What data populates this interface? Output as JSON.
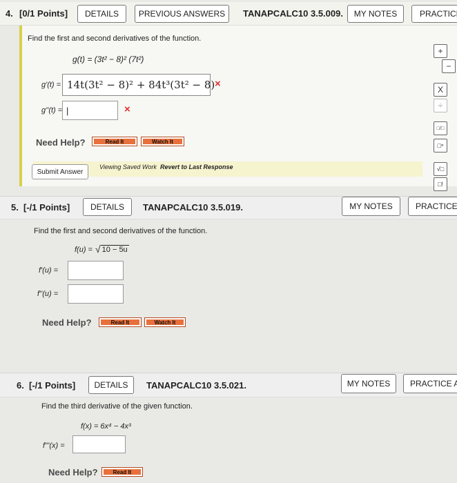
{
  "q4": {
    "number": "4.",
    "points": "[0/1 Points]",
    "details": "DETAILS",
    "previous_answers": "PREVIOUS ANSWERS",
    "code": "TANAPCALC10 3.5.009.",
    "my_notes": "MY NOTES",
    "practice": "PRACTICE",
    "prompt": "Find the first and second derivatives of the function.",
    "function": "g(t) = (3t² − 8)² (7t²)",
    "first_label": "g'(t) =",
    "first_answer": "14t(3t² − 8)² + 84t³(3t² − 8)",
    "second_label": "g''(t) =",
    "second_answer": "|",
    "wrong_mark": "×",
    "need_help": "Need Help?",
    "read_it": "Read It",
    "watch_it": "Watch It",
    "submit": "Submit Answer",
    "viewing_text": "Viewing Saved Work",
    "revert_text": "Revert to Last Response"
  },
  "tools": {
    "plus": "+",
    "minus": "−",
    "times": "X",
    "divide": "÷",
    "fraction": "□/□",
    "power": "□ⁿ",
    "sqrt": "√□",
    "factorial": "□!"
  },
  "q5": {
    "number": "5.",
    "points": "[-/1 Points]",
    "details": "DETAILS",
    "code": "TANAPCALC10 3.5.019.",
    "my_notes": "MY NOTES",
    "practice": "PRACTICE A",
    "prompt": "Find the first and second derivatives of the function.",
    "function_lhs": "f(u) =",
    "function_radicand": "10 − 5u",
    "first_label": "f'(u) =",
    "second_label": "f''(u) =",
    "need_help": "Need Help?",
    "read_it": "Read It",
    "watch_it": "Watch It"
  },
  "q6": {
    "number": "6.",
    "points": "[-/1 Points]",
    "details": "DETAILS",
    "code": "TANAPCALC10 3.5.021.",
    "my_notes": "MY NOTES",
    "practice": "PRACTICE AN",
    "prompt": "Find the third derivative of the given function.",
    "function": "f(x) = 6x⁴ − 4x³",
    "third_label": "f'''(x) =",
    "need_help": "Need Help?",
    "read_it": "Read It"
  },
  "colors": {
    "wrong": "#e03030",
    "help_button": "#e8703c",
    "viewing_bar": "#f6f3cf",
    "left_accent": "#d8d04a",
    "header_q4": "#f3f3ee",
    "header_q5": "#efefef"
  }
}
